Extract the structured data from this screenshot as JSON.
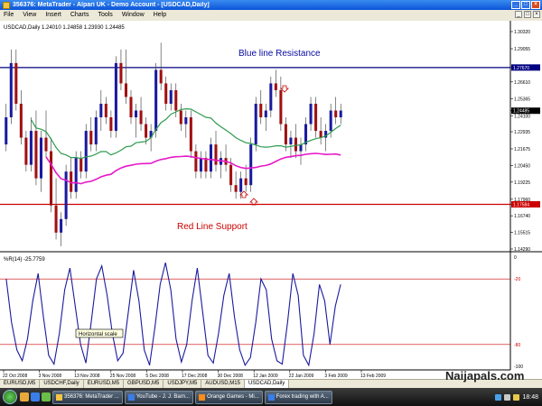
{
  "window": {
    "title": "356376: MetaTrader - Alpari UK - Demo Account - [USDCAD,Daily]"
  },
  "menubar": {
    "items": [
      "File",
      "View",
      "Insert",
      "Charts",
      "Tools",
      "Window",
      "Help"
    ]
  },
  "chart": {
    "header": "USDCAD,Daily  1.24010 1.24858 1.23930 1.24485",
    "osc_header": "%R(14) -25.7759",
    "price_axis": [
      "1.30320",
      "1.29055",
      "1.27670",
      "1.26610",
      "1.25365",
      "1.24485",
      "1.24100",
      "1.22935",
      "1.21675",
      "1.20450",
      "1.19225",
      "1.17960",
      "1.17584",
      "1.16740",
      "1.15515",
      "1.14290"
    ],
    "osc_axis": [
      "0",
      "-20",
      "-80",
      "-100"
    ],
    "time_axis": [
      "22 Oct 2008",
      "3 Nov 2008",
      "13 Nov 2008",
      "25 Nov 2008",
      "5 Dec 2008",
      "17 Dec 2008",
      "30 Dec 2008",
      "12 Jan 2009",
      "22 Jan 2009",
      "3 Feb 2009",
      "13 Feb 2009"
    ],
    "annotations": {
      "resistance": "Blue line Resistance",
      "support": "Red Line Support",
      "scale_tooltip": "Horizontal scale"
    },
    "resistance_level": 1.2767,
    "support_level": 1.17584,
    "current_price": 1.24485
  },
  "chart_data": {
    "type": "candlestick",
    "symbol": "USDCAD",
    "timeframe": "Daily",
    "ylim": [
      1.1429,
      1.3032
    ],
    "levels": {
      "resistance": 1.2767,
      "support": 1.17584
    },
    "indicator": {
      "name": "%R(14)",
      "last": -25.7759,
      "levels": [
        -20,
        -80
      ],
      "ylim": [
        -100,
        0
      ]
    },
    "candles": [
      [
        1.22,
        1.25,
        1.215,
        1.24
      ],
      [
        1.24,
        1.29,
        1.235,
        1.28
      ],
      [
        1.28,
        1.29,
        1.245,
        1.25
      ],
      [
        1.25,
        1.26,
        1.22,
        1.225
      ],
      [
        1.225,
        1.23,
        1.2,
        1.205
      ],
      [
        1.205,
        1.24,
        1.2,
        1.23
      ],
      [
        1.23,
        1.245,
        1.19,
        1.195
      ],
      [
        1.195,
        1.23,
        1.185,
        1.225
      ],
      [
        1.225,
        1.245,
        1.21,
        1.215
      ],
      [
        1.215,
        1.225,
        1.17,
        1.175
      ],
      [
        1.175,
        1.195,
        1.15,
        1.155
      ],
      [
        1.155,
        1.17,
        1.145,
        1.165
      ],
      [
        1.165,
        1.205,
        1.16,
        1.2
      ],
      [
        1.2,
        1.21,
        1.18,
        1.185
      ],
      [
        1.185,
        1.215,
        1.18,
        1.21
      ],
      [
        1.21,
        1.215,
        1.195,
        1.2
      ],
      [
        1.2,
        1.235,
        1.195,
        1.23
      ],
      [
        1.23,
        1.24,
        1.215,
        1.22
      ],
      [
        1.22,
        1.245,
        1.215,
        1.24
      ],
      [
        1.24,
        1.26,
        1.23,
        1.25
      ],
      [
        1.25,
        1.255,
        1.235,
        1.24
      ],
      [
        1.24,
        1.245,
        1.225,
        1.23
      ],
      [
        1.23,
        1.285,
        1.225,
        1.28
      ],
      [
        1.28,
        1.29,
        1.26,
        1.265
      ],
      [
        1.265,
        1.29,
        1.25,
        1.255
      ],
      [
        1.255,
        1.26,
        1.235,
        1.24
      ],
      [
        1.24,
        1.25,
        1.225,
        1.245
      ],
      [
        1.245,
        1.255,
        1.23,
        1.235
      ],
      [
        1.235,
        1.24,
        1.22,
        1.225
      ],
      [
        1.225,
        1.235,
        1.215,
        1.23
      ],
      [
        1.23,
        1.28,
        1.225,
        1.275
      ],
      [
        1.275,
        1.295,
        1.26,
        1.265
      ],
      [
        1.265,
        1.27,
        1.245,
        1.25
      ],
      [
        1.25,
        1.265,
        1.245,
        1.26
      ],
      [
        1.26,
        1.265,
        1.24,
        1.245
      ],
      [
        1.245,
        1.25,
        1.23,
        1.235
      ],
      [
        1.235,
        1.245,
        1.225,
        1.24
      ],
      [
        1.24,
        1.245,
        1.21,
        1.215
      ],
      [
        1.215,
        1.22,
        1.195,
        1.2
      ],
      [
        1.2,
        1.215,
        1.195,
        1.21
      ],
      [
        1.21,
        1.215,
        1.195,
        1.2
      ],
      [
        1.2,
        1.225,
        1.195,
        1.22
      ],
      [
        1.22,
        1.23,
        1.2,
        1.205
      ],
      [
        1.205,
        1.215,
        1.195,
        1.21
      ],
      [
        1.21,
        1.22,
        1.2,
        1.205
      ],
      [
        1.205,
        1.21,
        1.185,
        1.19
      ],
      [
        1.19,
        1.2,
        1.18,
        1.185
      ],
      [
        1.185,
        1.2,
        1.18,
        1.195
      ],
      [
        1.195,
        1.205,
        1.185,
        1.19
      ],
      [
        1.19,
        1.225,
        1.185,
        1.22
      ],
      [
        1.22,
        1.255,
        1.215,
        1.25
      ],
      [
        1.25,
        1.26,
        1.235,
        1.24
      ],
      [
        1.24,
        1.25,
        1.23,
        1.245
      ],
      [
        1.245,
        1.27,
        1.24,
        1.265
      ],
      [
        1.265,
        1.275,
        1.255,
        1.26
      ],
      [
        1.26,
        1.27,
        1.23,
        1.235
      ],
      [
        1.235,
        1.24,
        1.215,
        1.22
      ],
      [
        1.22,
        1.23,
        1.21,
        1.225
      ],
      [
        1.225,
        1.235,
        1.21,
        1.215
      ],
      [
        1.215,
        1.225,
        1.205,
        1.22
      ],
      [
        1.22,
        1.24,
        1.215,
        1.235
      ],
      [
        1.235,
        1.255,
        1.23,
        1.25
      ],
      [
        1.25,
        1.255,
        1.225,
        1.23
      ],
      [
        1.23,
        1.24,
        1.22,
        1.225
      ],
      [
        1.225,
        1.235,
        1.215,
        1.23
      ],
      [
        1.23,
        1.25,
        1.225,
        1.245
      ],
      [
        1.245,
        1.255,
        1.235,
        1.24
      ],
      [
        1.24,
        1.25,
        1.235,
        1.245
      ]
    ],
    "williams_r": [
      -20,
      -60,
      -85,
      -95,
      -75,
      -40,
      -15,
      -55,
      -90,
      -98,
      -70,
      -30,
      -10,
      -45,
      -80,
      -97,
      -60,
      -20,
      -8,
      -35,
      -70,
      -95,
      -88,
      -50,
      -12,
      -40,
      -85,
      -99,
      -65,
      -25,
      -5,
      -30,
      -75,
      -96,
      -80,
      -40,
      -10,
      -50,
      -90,
      -97,
      -70,
      -35,
      -15,
      -55,
      -85,
      -99,
      -92,
      -60,
      -20,
      -30,
      -75,
      -95,
      -98,
      -60,
      -15,
      -35,
      -90,
      -99,
      -70,
      -25,
      -40,
      -80,
      -45,
      -25
    ]
  },
  "bottom_tabs": [
    "EURUSD,M5",
    "USDCHF,Daily",
    "EURUSD,M5",
    "GBPUSD,M5",
    "USDJPY,M5",
    "AUDUSD,M15",
    "USDCAD,Daily"
  ],
  "taskbar": {
    "tasks": [
      "356376: MetaTrader ...",
      "YouTube - J. J. Barn...",
      "Orange Games - Mi...",
      "Forex trading with A..."
    ],
    "clock": "18:48"
  },
  "watermark": "Naijapals.com",
  "colors": {
    "resistance": "#000080",
    "support": "#cc0000",
    "ma_fast": "#2e9b4e",
    "ma_slow": "#e619c8",
    "bull": "#1a1a9e",
    "bear": "#a01010",
    "osc": "#1a1a9e"
  }
}
